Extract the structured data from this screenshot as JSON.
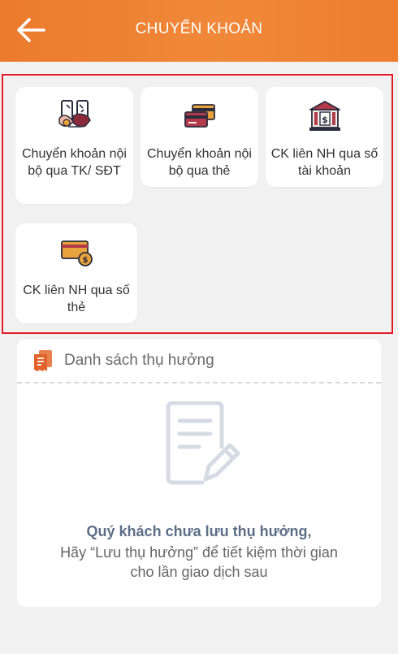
{
  "header": {
    "title": "CHUYỂN KHOẢN",
    "back_icon": "arrow-left-icon",
    "color": "#ee7d2f"
  },
  "services": [
    {
      "label": "Chuyển khoản nội bộ qua TK/ SĐT",
      "icon": "phone-transfer-icon"
    },
    {
      "label": "Chuyển khoản nội bộ qua thẻ",
      "icon": "cards-icon"
    },
    {
      "label": "CK liên NH qua số tài khoản",
      "icon": "bank-icon"
    },
    {
      "label": "CK liên NH qua số thẻ",
      "icon": "card-coin-icon"
    }
  ],
  "beneficiaries": {
    "title": "Danh sách thụ hưởng",
    "icon": "receipt-list-icon",
    "empty_icon": "document-edit-icon",
    "empty_title": "Quý khách chưa lưu thụ hưởng,",
    "empty_desc_line1": "Hãy “Lưu thụ hưởng” để tiết kiệm thời gian",
    "empty_desc_line2": "cho lần giao dịch sau"
  },
  "colors": {
    "accent": "#ee7d2f",
    "highlight_border": "#e21d2a",
    "background": "#f1f1f1"
  }
}
